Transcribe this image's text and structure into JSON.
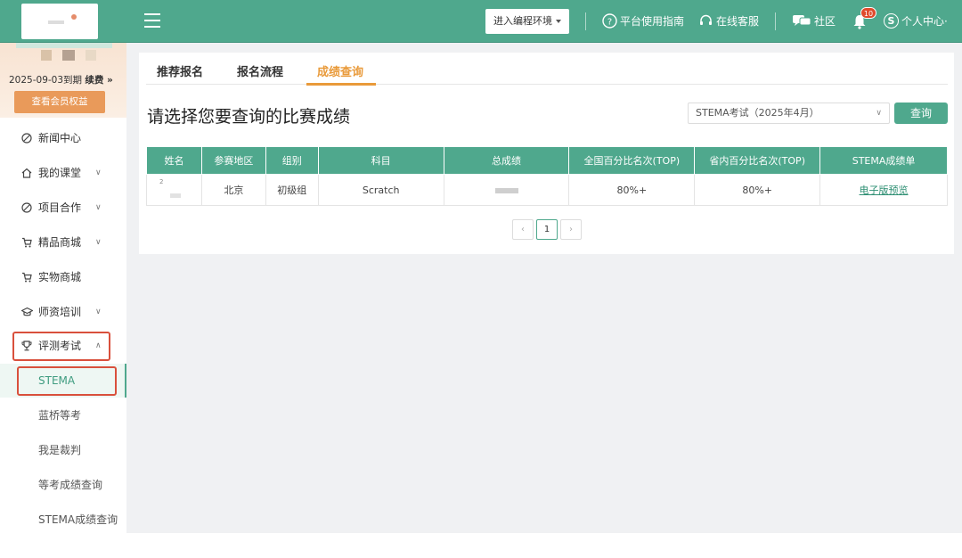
{
  "header": {
    "env_button": "进入编程环境",
    "guide": "平台使用指南",
    "service": "在线客服",
    "community": "社区",
    "notify_count": "10",
    "avatar_letter": "S",
    "personal": "个人中心·",
    "brand_color": "#4fa88d"
  },
  "sidebar": {
    "expire_text": "2025-09-03到期",
    "renew_text": "续费 »",
    "vip_button": "查看会员权益",
    "items": [
      {
        "label": "新闻中心",
        "icon": "slash-circle-icon"
      },
      {
        "label": "我的课堂",
        "icon": "home-icon",
        "chevron": "∨"
      },
      {
        "label": "项目合作",
        "icon": "slash-circle-icon",
        "chevron": "∨"
      },
      {
        "label": "精品商城",
        "icon": "cart-icon",
        "chevron": "∨"
      },
      {
        "label": "实物商城",
        "icon": "cart-icon"
      },
      {
        "label": "师资培训",
        "icon": "graduation-cap-icon",
        "chevron": "∨"
      },
      {
        "label": "评测考试",
        "icon": "trophy-icon",
        "chevron": "∧"
      }
    ],
    "subitems": [
      "STEMA",
      "蓝桥等考",
      "我是裁判",
      "等考成绩查询",
      "STEMA成绩查询"
    ]
  },
  "tabs": [
    "推荐报名",
    "报名流程",
    "成绩查询"
  ],
  "main": {
    "title": "请选择您要查询的比赛成绩",
    "select_value": "STEMA考试（2025年4月）",
    "query_button": "查询",
    "accent_color": "#e99a3a"
  },
  "table": {
    "headers": [
      "姓名",
      "参赛地区",
      "组别",
      "科目",
      "总成绩",
      "全国百分比名次(TOP)",
      "省内百分比名次(TOP)",
      "STEMA成绩单"
    ],
    "row": {
      "region": "北京",
      "group": "初级组",
      "subject": "Scratch",
      "national": "80%+",
      "province": "80%+",
      "report": "电子版预览"
    }
  },
  "pagination": {
    "prev": "‹",
    "current": "1",
    "next": "›"
  }
}
